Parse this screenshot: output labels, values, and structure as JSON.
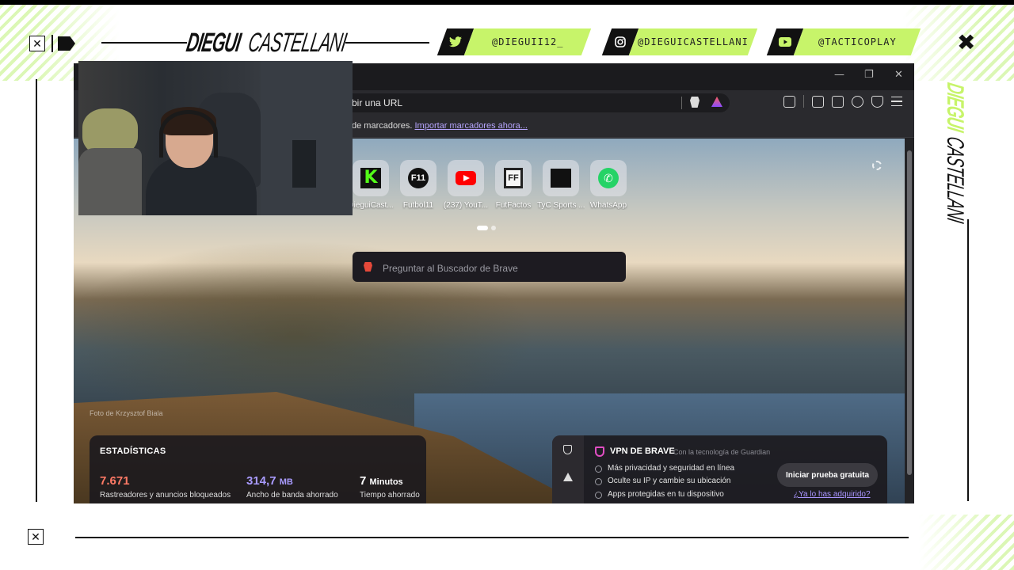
{
  "overlay": {
    "title_bold": "DIEGUI",
    "title_light": "CASTELLANI",
    "socials": [
      {
        "icon": "twitter-icon",
        "handle": "@DIEGUII12_"
      },
      {
        "icon": "instagram-icon",
        "handle": "@DIEGUICASTELLANI"
      },
      {
        "icon": "youtube-icon",
        "handle": "@TACTICOPLAY"
      }
    ],
    "side_title_bold": "DIEGUI",
    "side_title_light": "CASTELLANI",
    "accent_color": "#c7f46a"
  },
  "browser": {
    "url_text": "bir una URL",
    "bookmarks_text": "de marcadores.",
    "bookmarks_link": "Importar marcadores ahora...",
    "tiles": [
      {
        "label": "DieguiCast...",
        "icon": "kick-icon"
      },
      {
        "label": "Futbol11",
        "icon": "futbol11-icon",
        "glyph": "F11"
      },
      {
        "label": "(237) YouT...",
        "icon": "youtube-icon"
      },
      {
        "label": "FutFactos",
        "icon": "futfactos-icon",
        "glyph": "FF"
      },
      {
        "label": "TyC Sports ...",
        "icon": "tyc-sports-icon"
      },
      {
        "label": "WhatsApp",
        "icon": "whatsapp-icon",
        "glyph": "✆"
      }
    ],
    "search_placeholder": "Preguntar al Buscador de Brave",
    "photo_credit": "Foto de Krzysztof Biala",
    "stats": {
      "title": "ESTADÍSTICAS",
      "items": [
        {
          "value": "7.671",
          "unit": "",
          "label": "Rastreadores y anuncios bloqueados",
          "color": "#ff7a66"
        },
        {
          "value": "314,7",
          "unit": "MB",
          "label": "Ancho de banda ahorrado",
          "color": "#a99bff"
        },
        {
          "value": "7",
          "unit": "Minutos",
          "label": "Tiempo ahorrado",
          "color": "#ffffff"
        }
      ]
    },
    "vpn": {
      "title": "VPN DE BRAVE",
      "powered_by": "Con la tecnología de Guardian",
      "items": [
        "Más privacidad y seguridad en línea",
        "Oculte su IP y cambie su ubicación",
        "Apps protegidas en tu dispositivo"
      ],
      "button": "Iniciar prueba gratuita",
      "link": "¿Ya lo has adquirido?"
    }
  }
}
